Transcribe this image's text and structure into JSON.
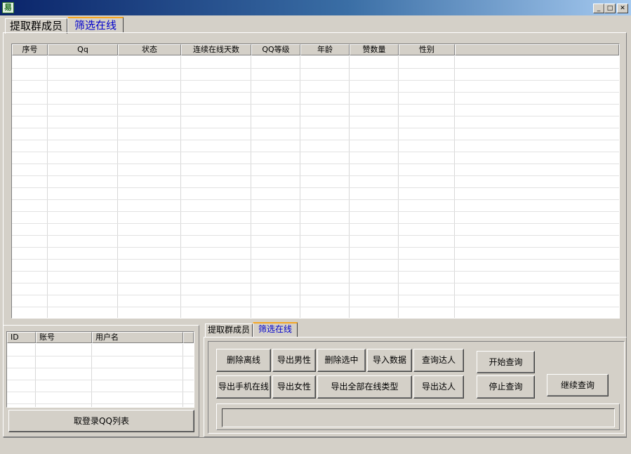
{
  "window": {
    "icon_glyph": "易",
    "controls": {
      "minimize": "_",
      "maximize": "□",
      "close": "✕"
    }
  },
  "top_tabs": [
    {
      "label": "提取群成员",
      "active": false
    },
    {
      "label": "筛选在线",
      "active": true
    }
  ],
  "main_table": {
    "columns": [
      "序号",
      "Qq",
      "状态",
      "连续在线天数",
      "QQ等级",
      "年龄",
      "赞数量",
      "性别"
    ],
    "rows": []
  },
  "account_table": {
    "columns": [
      "ID",
      "账号",
      "用户名"
    ],
    "rows": []
  },
  "login_list_button": "取登录QQ列表",
  "bottom_tabs": [
    {
      "label": "提取群成员",
      "active": false
    },
    {
      "label": "筛选在线",
      "active": true
    }
  ],
  "actions": {
    "delete_offline": "删除离线",
    "export_male": "导出男性",
    "delete_selected": "删除选中",
    "import_data": "导入数据",
    "query_expert": "查询达人",
    "start_query": "开始查询",
    "export_mobile_online": "导出手机在线",
    "export_female": "导出女性",
    "export_all_online_types": "导出全部在线类型",
    "export_expert": "导出达人",
    "stop_query": "停止查询",
    "continue_query": "继续查询"
  },
  "status_field": ""
}
